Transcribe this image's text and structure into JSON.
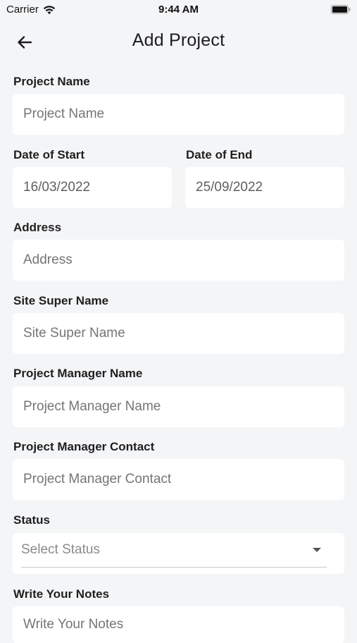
{
  "status_bar": {
    "carrier": "Carrier",
    "time": "9:44 AM"
  },
  "header": {
    "title": "Add Project",
    "back_icon": "arrow-left-icon"
  },
  "form": {
    "project_name": {
      "label": "Project Name",
      "placeholder": "Project Name",
      "value": ""
    },
    "date_of_start": {
      "label": "Date of Start",
      "value": "16/03/2022"
    },
    "date_of_end": {
      "label": "Date of End",
      "value": "25/09/2022"
    },
    "address": {
      "label": "Address",
      "placeholder": "Address",
      "value": ""
    },
    "site_super_name": {
      "label": "Site Super Name",
      "placeholder": "Site Super Name",
      "value": ""
    },
    "project_manager_name": {
      "label": "Project Manager Name",
      "placeholder": "Project Manager Name",
      "value": ""
    },
    "project_manager_contact": {
      "label": "Project Manager Contact",
      "placeholder": "Project Manager Contact",
      "value": ""
    },
    "status": {
      "label": "Status",
      "selected": "Select Status"
    },
    "notes": {
      "label": "Write Your Notes",
      "placeholder": "Write Your Notes",
      "value": ""
    }
  }
}
